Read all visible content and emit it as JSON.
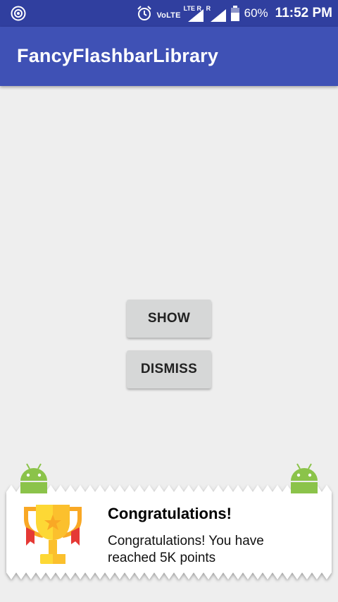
{
  "status_bar": {
    "network_label": "VoLTE",
    "signal1_tag": "LTE R",
    "signal2_tag": "R",
    "battery": "60%",
    "time": "11:52 PM"
  },
  "app_bar": {
    "title": "FancyFlashbarLibrary"
  },
  "buttons": {
    "show": "SHOW",
    "dismiss": "DISMISS"
  },
  "flashbar": {
    "title": "Congratulations!",
    "message": "Congratulations! You have reached 5K points",
    "icon": "trophy-icon",
    "accent_colors": {
      "android": "#8bc34a",
      "trophy": "#fbc02d",
      "ribbon": "#e53935"
    }
  },
  "colors": {
    "primary": "#3f51b5",
    "primary_dark": "#303f9f",
    "background": "#eeeeee"
  }
}
